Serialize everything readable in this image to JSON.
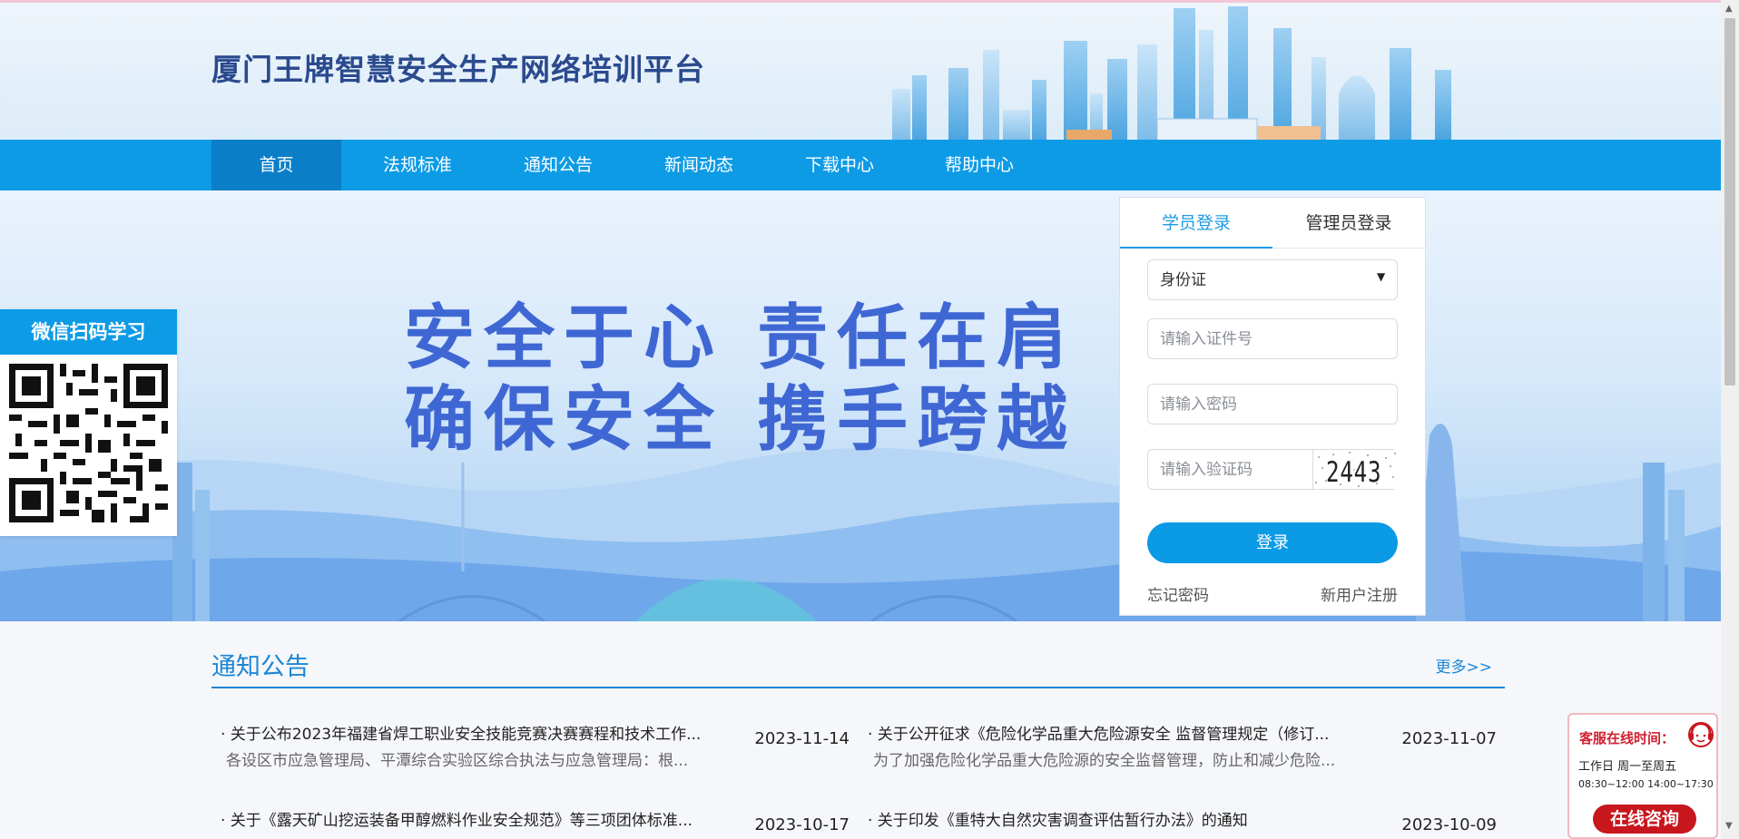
{
  "header": {
    "site_title": "厦门王牌智慧安全生产网络培训平台"
  },
  "nav": {
    "items": [
      {
        "label": "首页",
        "active": true
      },
      {
        "label": "法规标准"
      },
      {
        "label": "通知公告"
      },
      {
        "label": "新闻动态"
      },
      {
        "label": "下载中心"
      },
      {
        "label": "帮助中心"
      }
    ]
  },
  "banner": {
    "slogan_line1": "安全于心  责任在肩",
    "slogan_line2": "确保安全  携手跨越"
  },
  "qr": {
    "title": "微信扫码学习"
  },
  "login": {
    "tab_student": "学员登录",
    "tab_admin": "管理员登录",
    "id_type_selected": "身份证",
    "id_placeholder": "请输入证件号",
    "password_placeholder": "请输入密码",
    "captcha_placeholder": "请输入验证码",
    "captcha_code": "2443",
    "submit_label": "登录",
    "forgot_label": "忘记密码",
    "register_label": "新用户注册"
  },
  "notices": {
    "title": "通知公告",
    "more_label": "更多>>",
    "items": [
      {
        "title": "· 关于公布2023年福建省焊工职业安全技能竞赛决赛赛程和技术工作...",
        "date": "2023-11-14",
        "summary": "各设区市应急管理局、平潭综合实验区综合执法与应急管理局：根..."
      },
      {
        "title": "· 关于公开征求《危险化学品重大危险源安全 监督管理规定（修订...",
        "date": "2023-11-07",
        "summary": "为了加强危险化学品重大危险源的安全监督管理，防止和减少危险..."
      },
      {
        "title": "· 关于《露天矿山挖运装备甲醇燃料作业安全规范》等三项团体标准...",
        "date": "2023-10-17",
        "summary": ""
      },
      {
        "title": "· 关于印发《重特大自然灾害调查评估暂行办法》的通知",
        "date": "2023-10-09",
        "summary": ""
      }
    ]
  },
  "customer_service": {
    "title": "客服在线时间：",
    "days": "工作日  周一至周五",
    "hours": "08:30~12:00  14:00~17:30",
    "button_label": "在线咨询"
  }
}
